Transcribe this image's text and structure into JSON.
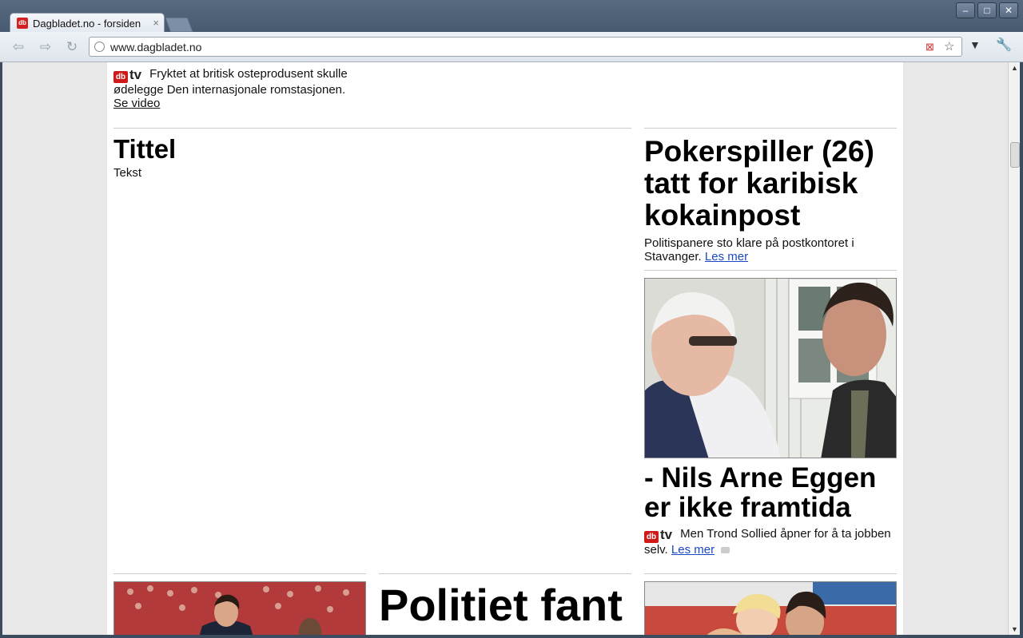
{
  "browser": {
    "tab_title": "Dagbladet.no - forsiden",
    "tab_close": "×",
    "favicon_text": "db",
    "url": "www.dagbladet.no",
    "window_buttons": [
      "–",
      "□",
      "✕"
    ]
  },
  "content": {
    "tv_logo": "tv",
    "db_logo": "db",
    "top_video": {
      "text": "Fryktet at britisk osteprodusent skulle ødelegge Den internasjonale romstasjonen.",
      "link": "Se video"
    },
    "placeholder": {
      "title": "Tittel",
      "text": "Tekst"
    },
    "story1": {
      "headline": "Pokerspiller (26) tatt for karibisk kokainpost",
      "summary": "Politispanere sto klare på postkontoret i Stavanger.",
      "link": "Les mer"
    },
    "story2": {
      "headline": "- Nils Arne Eggen er ikke framtida",
      "summary": "Men Trond Sollied åpner for å ta jobben selv.",
      "link": "Les mer"
    },
    "story3": {
      "headline": "Politiet fant"
    }
  },
  "colors": {
    "link": "#1a48c4",
    "brand_red": "#d01a1a",
    "chrome": "#485a70"
  }
}
